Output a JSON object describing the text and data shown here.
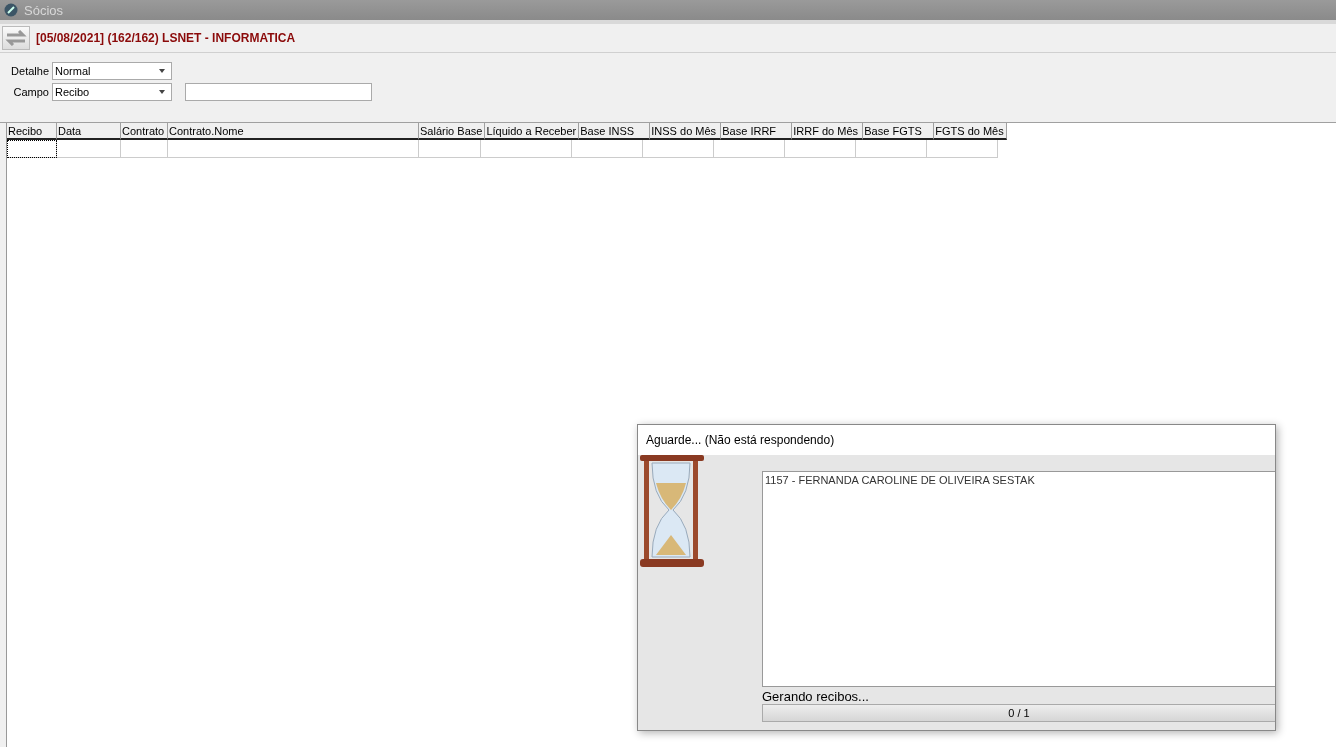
{
  "window": {
    "title": "Sócios"
  },
  "header": {
    "title": "[05/08/2021] (162/162) LSNET - INFORMATICA"
  },
  "filters": [
    {
      "label": "Detalhe",
      "kind": "select",
      "value": "Normal"
    },
    {
      "label": "Campo",
      "kind": "select",
      "value": "Recibo"
    }
  ],
  "table": {
    "columns": [
      {
        "label": "Recibo"
      },
      {
        "label": "Data"
      },
      {
        "label": "Contrato"
      },
      {
        "label": "Contrato.Nome"
      },
      {
        "label": "Salário Base"
      },
      {
        "label": "Líquido a Receber"
      },
      {
        "label": "Base INSS"
      },
      {
        "label": "INSS do Mês"
      },
      {
        "label": "Base IRRF"
      },
      {
        "label": "IRRF do Mês"
      },
      {
        "label": "Base FGTS"
      },
      {
        "label": "FGTS do Mês"
      }
    ]
  },
  "dialog": {
    "title": "Aguarde... (Não está respondendo)",
    "log": "1157 - FERNANDA CAROLINE DE OLIVEIRA SESTAK",
    "status": "Gerando recibos...",
    "progress": {
      "level": 0,
      "reading": "0 / 1"
    }
  }
}
